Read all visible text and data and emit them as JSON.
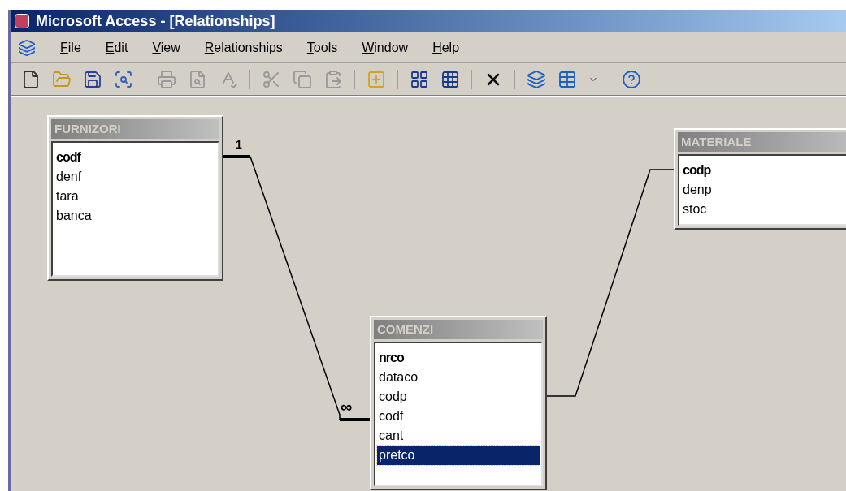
{
  "window": {
    "title": "Microsoft Access - [Relationships]"
  },
  "menu": [
    {
      "label": "File"
    },
    {
      "label": "Edit"
    },
    {
      "label": "View"
    },
    {
      "label": "Relationships"
    },
    {
      "label": "Tools"
    },
    {
      "label": "Window"
    },
    {
      "label": "Help"
    }
  ],
  "tables": [
    {
      "name": "FURNIZORI",
      "fields": [
        {
          "name": "codf",
          "key": true,
          "selected": false
        },
        {
          "name": "denf",
          "key": false,
          "selected": false
        },
        {
          "name": "tara",
          "key": false,
          "selected": false
        },
        {
          "name": "banca",
          "key": false,
          "selected": false
        }
      ]
    },
    {
      "name": "MATERIALE",
      "fields": [
        {
          "name": "codp",
          "key": true,
          "selected": false
        },
        {
          "name": "denp",
          "key": false,
          "selected": false
        },
        {
          "name": "stoc",
          "key": false,
          "selected": false
        }
      ]
    },
    {
      "name": "COMENZI",
      "fields": [
        {
          "name": "nrco",
          "key": true,
          "selected": false
        },
        {
          "name": "dataco",
          "key": false,
          "selected": false
        },
        {
          "name": "codp",
          "key": false,
          "selected": false
        },
        {
          "name": "codf",
          "key": false,
          "selected": false
        },
        {
          "name": "cant",
          "key": false,
          "selected": false
        },
        {
          "name": "pretco",
          "key": false,
          "selected": true
        }
      ]
    }
  ],
  "relationship": {
    "one_label": "1",
    "many_label": "∞"
  }
}
